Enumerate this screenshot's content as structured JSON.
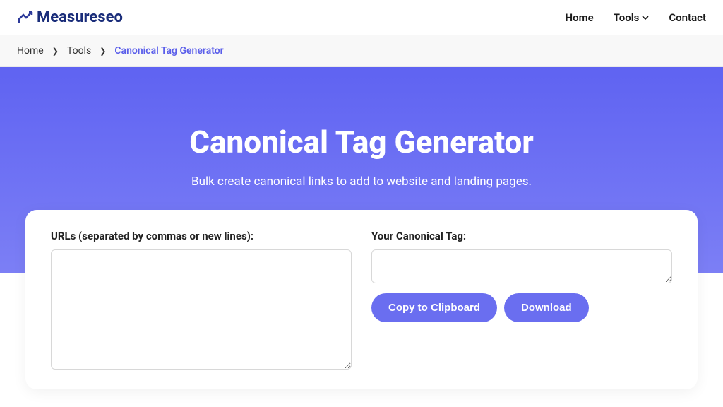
{
  "logo": {
    "text": "Measureseo"
  },
  "nav": {
    "home": "Home",
    "tools": "Tools",
    "contact": "Contact"
  },
  "breadcrumb": {
    "home": "Home",
    "tools": "Tools",
    "current": "Canonical Tag Generator"
  },
  "hero": {
    "title": "Canonical Tag Generator",
    "subtitle": "Bulk create canonical links to add to website and landing pages."
  },
  "form": {
    "urls_label": "URLs (separated by commas or new lines):",
    "output_label": "Your Canonical Tag:",
    "urls_value": "",
    "output_value": "",
    "copy_button": "Copy to Clipboard",
    "download_button": "Download"
  }
}
